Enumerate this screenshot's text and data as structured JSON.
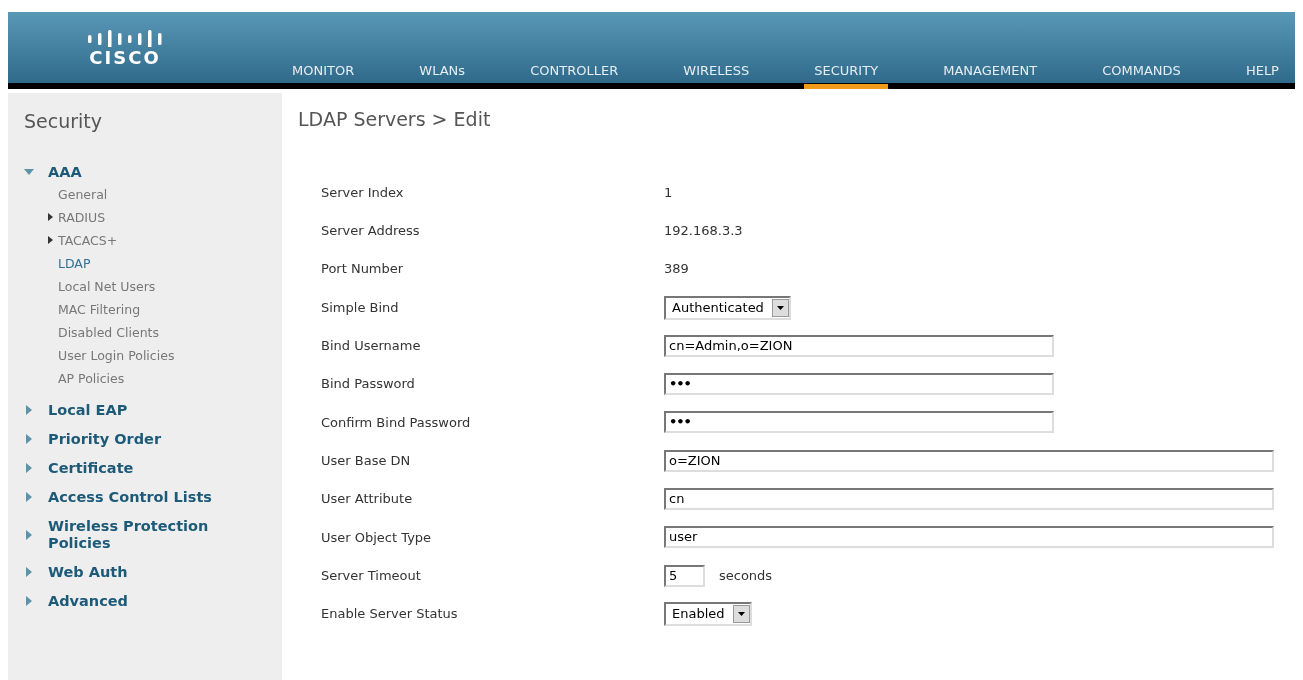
{
  "header": {
    "logo": "CISCO",
    "nav": [
      {
        "label": "MONITOR",
        "selected": false
      },
      {
        "label": "WLANs",
        "selected": false
      },
      {
        "label": "CONTROLLER",
        "selected": false
      },
      {
        "label": "WIRELESS",
        "selected": false
      },
      {
        "label": "SECURITY",
        "selected": true
      },
      {
        "label": "MANAGEMENT",
        "selected": false
      },
      {
        "label": "COMMANDS",
        "selected": false
      },
      {
        "label": "HELP",
        "selected": false
      }
    ]
  },
  "sidebar": {
    "title": "Security",
    "sections": [
      {
        "label": "AAA",
        "expanded": true,
        "children": [
          {
            "label": "General",
            "kind": "leaf",
            "selected": false
          },
          {
            "label": "RADIUS",
            "kind": "group",
            "selected": false
          },
          {
            "label": "TACACS+",
            "kind": "group",
            "selected": false
          },
          {
            "label": "LDAP",
            "kind": "leaf",
            "selected": true
          },
          {
            "label": "Local Net Users",
            "kind": "leaf",
            "selected": false
          },
          {
            "label": "MAC Filtering",
            "kind": "leaf",
            "selected": false
          },
          {
            "label": "Disabled Clients",
            "kind": "leaf",
            "selected": false
          },
          {
            "label": "User Login Policies",
            "kind": "leaf",
            "selected": false
          },
          {
            "label": "AP Policies",
            "kind": "leaf",
            "selected": false
          }
        ]
      },
      {
        "label": "Local EAP",
        "expanded": false
      },
      {
        "label": "Priority Order",
        "expanded": false
      },
      {
        "label": "Certificate",
        "expanded": false
      },
      {
        "label": "Access Control Lists",
        "expanded": false
      },
      {
        "label": "Wireless Protection Policies",
        "expanded": false
      },
      {
        "label": "Web Auth",
        "expanded": false
      },
      {
        "label": "Advanced",
        "expanded": false
      }
    ]
  },
  "content": {
    "title": "LDAP Servers > Edit",
    "fields": [
      {
        "label": "Server Index",
        "kind": "text",
        "value": "1"
      },
      {
        "label": "Server Address",
        "kind": "text",
        "value": "192.168.3.3"
      },
      {
        "label": "Port Number",
        "kind": "text",
        "value": "389"
      },
      {
        "label": "Simple Bind",
        "kind": "select",
        "value": "Authenticated"
      },
      {
        "label": "Bind Username",
        "kind": "input",
        "value": "cn=Admin,o=ZION"
      },
      {
        "label": "Bind Password",
        "kind": "password",
        "value": "•••"
      },
      {
        "label": "Confirm Bind Password",
        "kind": "password",
        "value": "•••"
      },
      {
        "label": "User Base DN",
        "kind": "wide",
        "value": "o=ZION"
      },
      {
        "label": "User Attribute",
        "kind": "wide",
        "value": "cn"
      },
      {
        "label": "User Object Type",
        "kind": "wide",
        "value": "user"
      },
      {
        "label": "Server Timeout",
        "kind": "unit",
        "value": "5",
        "unit": "seconds"
      },
      {
        "label": "Enable Server Status",
        "kind": "select",
        "value": "Enabled"
      }
    ]
  }
}
